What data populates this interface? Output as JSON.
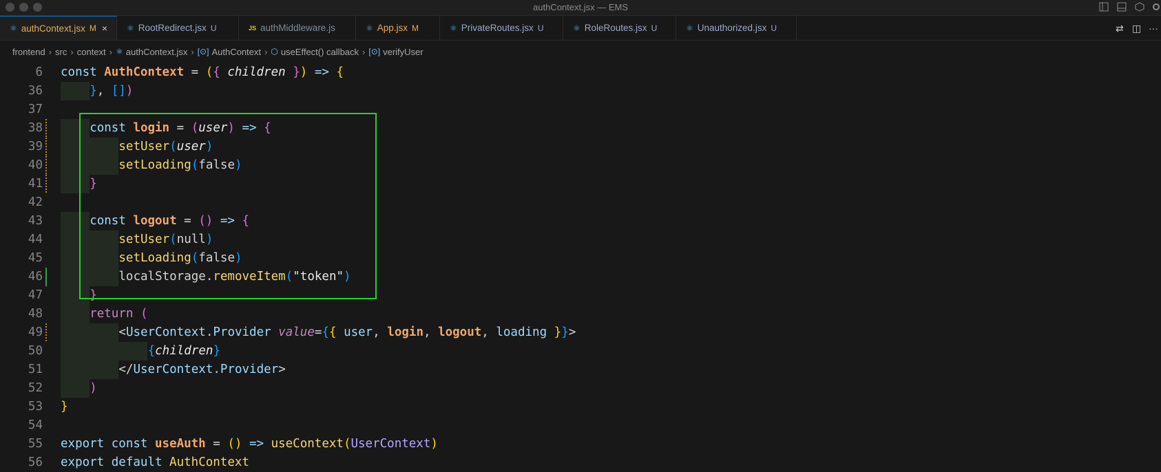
{
  "window": {
    "title": "authContext.jsx — EMS"
  },
  "tabs": [
    {
      "label": "authContext.jsx",
      "badge": "M",
      "icon": "react-icon",
      "active": true
    },
    {
      "label": "RootRedirect.jsx",
      "badge": "U",
      "icon": "react-icon"
    },
    {
      "label": "authMiddleware.js",
      "badge": "",
      "icon": "js-icon",
      "icon_text": "JS"
    },
    {
      "label": "App.jsx",
      "badge": "M",
      "icon": "react-icon"
    },
    {
      "label": "PrivateRoutes.jsx",
      "badge": "U",
      "icon": "react-icon"
    },
    {
      "label": "RoleRoutes.jsx",
      "badge": "U",
      "icon": "react-icon"
    },
    {
      "label": "Unauthorized.jsx",
      "badge": "U",
      "icon": "react-icon"
    }
  ],
  "breadcrumb": [
    "frontend",
    "src",
    "context",
    "authContext.jsx",
    "AuthContext",
    "useEffect() callback",
    "verifyUser"
  ],
  "lines": [
    {
      "n": "6",
      "tokens": [
        [
          "kw",
          "const "
        ],
        [
          "fn",
          "AuthContext"
        ],
        [
          "plain",
          " = "
        ],
        [
          "b1",
          "("
        ],
        [
          "b2",
          "{ "
        ],
        [
          "param",
          "children"
        ],
        [
          "b2",
          " }"
        ],
        [
          "b1",
          ")"
        ],
        [
          "kw",
          " => "
        ],
        [
          "b1",
          "{"
        ]
      ]
    },
    {
      "n": "36",
      "tokens": [
        [
          "b3",
          "}"
        ],
        [
          "plain",
          ", "
        ],
        [
          "b3",
          "[]"
        ],
        [
          "b2",
          ")"
        ]
      ]
    },
    {
      "n": "37",
      "tokens": []
    },
    {
      "n": "38",
      "tokens": [
        [
          "kw",
          "const "
        ],
        [
          "fn",
          "login"
        ],
        [
          "plain",
          " = "
        ],
        [
          "b2",
          "("
        ],
        [
          "param",
          "user"
        ],
        [
          "b2",
          ")"
        ],
        [
          "kw",
          " => "
        ],
        [
          "b2",
          "{"
        ]
      ]
    },
    {
      "n": "39",
      "tokens": [
        [
          "call",
          "setUser"
        ],
        [
          "b3",
          "("
        ],
        [
          "param",
          "user"
        ],
        [
          "b3",
          ")"
        ]
      ]
    },
    {
      "n": "40",
      "tokens": [
        [
          "call",
          "setLoading"
        ],
        [
          "b3",
          "("
        ],
        [
          "plain",
          "false"
        ],
        [
          "b3",
          ")"
        ]
      ]
    },
    {
      "n": "41",
      "tokens": [
        [
          "b2",
          "}"
        ]
      ]
    },
    {
      "n": "42",
      "tokens": []
    },
    {
      "n": "43",
      "tokens": [
        [
          "kw",
          "const "
        ],
        [
          "fn",
          "logout"
        ],
        [
          "plain",
          " = "
        ],
        [
          "b2",
          "()"
        ],
        [
          "kw",
          " => "
        ],
        [
          "b2",
          "{"
        ]
      ]
    },
    {
      "n": "44",
      "tokens": [
        [
          "call",
          "setUser"
        ],
        [
          "b3",
          "("
        ],
        [
          "plain",
          "null"
        ],
        [
          "b3",
          ")"
        ]
      ]
    },
    {
      "n": "45",
      "tokens": [
        [
          "call",
          "setLoading"
        ],
        [
          "b3",
          "("
        ],
        [
          "plain",
          "false"
        ],
        [
          "b3",
          ")"
        ]
      ]
    },
    {
      "n": "46",
      "tokens": [
        [
          "plain",
          "localStorage."
        ],
        [
          "call",
          "removeItem"
        ],
        [
          "b3",
          "("
        ],
        [
          "str",
          "\"token\""
        ],
        [
          "b3",
          ")"
        ]
      ]
    },
    {
      "n": "47",
      "tokens": [
        [
          "b2",
          "}"
        ]
      ]
    },
    {
      "n": "48",
      "tokens": [
        [
          "kw2",
          "return "
        ],
        [
          "b2",
          "("
        ]
      ]
    },
    {
      "n": "49",
      "tokens": [
        [
          "plain",
          "<"
        ],
        [
          "tag",
          "UserContext.Provider "
        ],
        [
          "attr",
          "value"
        ],
        [
          "plain",
          "="
        ],
        [
          "b3",
          "{"
        ],
        [
          "b1",
          "{ "
        ],
        [
          "ident",
          "user"
        ],
        [
          "plain",
          ", "
        ],
        [
          "fn",
          "login"
        ],
        [
          "plain",
          ", "
        ],
        [
          "fn",
          "logout"
        ],
        [
          "plain",
          ", "
        ],
        [
          "ident",
          "loading"
        ],
        [
          "b1",
          " }"
        ],
        [
          "b3",
          "}"
        ],
        [
          "plain",
          ">"
        ]
      ]
    },
    {
      "n": "50",
      "tokens": [
        [
          "b3",
          "{"
        ],
        [
          "param",
          "children"
        ],
        [
          "b3",
          "}"
        ]
      ]
    },
    {
      "n": "51",
      "tokens": [
        [
          "plain",
          "</"
        ],
        [
          "tag",
          "UserContext.Provider"
        ],
        [
          "plain",
          ">"
        ]
      ]
    },
    {
      "n": "52",
      "tokens": [
        [
          "b2",
          ")"
        ]
      ]
    },
    {
      "n": "53",
      "tokens": [
        [
          "b1",
          "}"
        ]
      ]
    },
    {
      "n": "54",
      "tokens": []
    },
    {
      "n": "55",
      "tokens": [
        [
          "kw",
          "export const "
        ],
        [
          "fn",
          "useAuth"
        ],
        [
          "plain",
          " = "
        ],
        [
          "b1",
          "()"
        ],
        [
          "kw",
          " => "
        ],
        [
          "call",
          "useContext"
        ],
        [
          "b1",
          "("
        ],
        [
          "cls",
          "UserContext"
        ],
        [
          "b1",
          ")"
        ]
      ]
    },
    {
      "n": "56",
      "tokens": [
        [
          "kw",
          "export default "
        ],
        [
          "call",
          "AuthContext"
        ]
      ]
    }
  ],
  "highlight_color": "#22d32a"
}
